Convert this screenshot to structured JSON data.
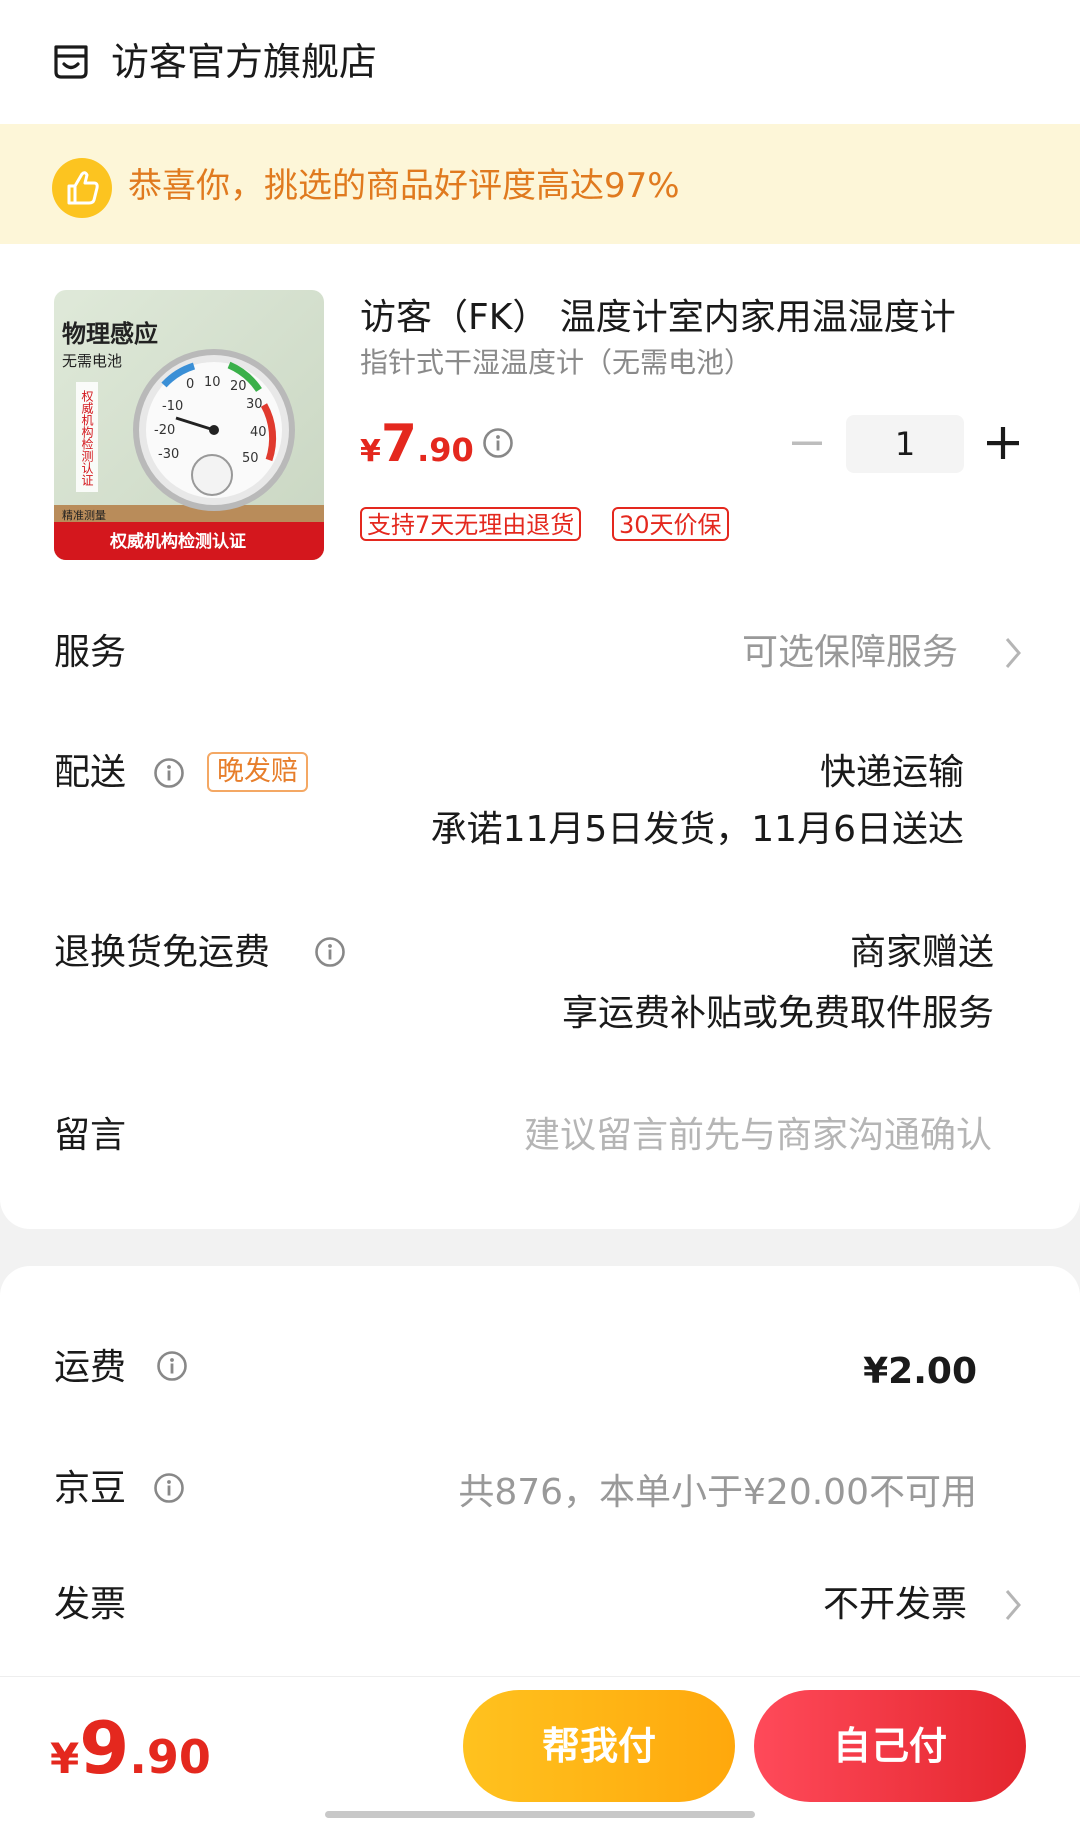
{
  "shop": {
    "icon": "shop-icon",
    "name": "访客官方旗舰店"
  },
  "notice": {
    "icon": "thumbs-up-icon",
    "text": "恭喜你，挑选的商品好评度高达97%"
  },
  "product": {
    "image": {
      "headline": "物理感应",
      "subline": "无需电池",
      "side_text": "权威机构检测认证",
      "bottom_text": "权威机构检测认证",
      "corner_text": "精准测量",
      "dial_numbers": [
        "-30",
        "-20",
        "-10",
        "0",
        "10",
        "20",
        "30",
        "40",
        "50"
      ]
    },
    "title": "访客（FK） 温度计室内家用温湿度计",
    "subtitle": "指针式干湿温度计（无需电池）",
    "price": {
      "currency": "¥",
      "integer": "7",
      "decimal": ".90"
    },
    "quantity": "1",
    "tags": [
      "支持7天无理由退货",
      "30天价保"
    ]
  },
  "service": {
    "label": "服务",
    "value": "可选保障服务"
  },
  "delivery": {
    "label": "配送",
    "tag": "晚发赔",
    "method": "快递运输",
    "promise": "承诺11月5日发货，11月6日送达"
  },
  "return_shipping": {
    "label": "退换货免运费",
    "value_line1": "商家赠送",
    "value_line2": "享运费补贴或免费取件服务"
  },
  "message": {
    "label": "留言",
    "placeholder": "建议留言前先与商家沟通确认"
  },
  "freight": {
    "label": "运费",
    "value": "¥2.00"
  },
  "jingdou": {
    "label": "京豆",
    "value": "共876，本单小于¥20.00不可用"
  },
  "invoice": {
    "label": "发票",
    "value": "不开发票"
  },
  "footer": {
    "total": {
      "currency": "¥",
      "integer": "9",
      "decimal": ".90"
    },
    "help_pay_label": "帮我付",
    "self_pay_label": "自己付"
  },
  "colors": {
    "accent_red": "#e4281e",
    "accent_orange": "#e07a1f",
    "help_button": "#ffb515",
    "self_button": "#f03642"
  }
}
